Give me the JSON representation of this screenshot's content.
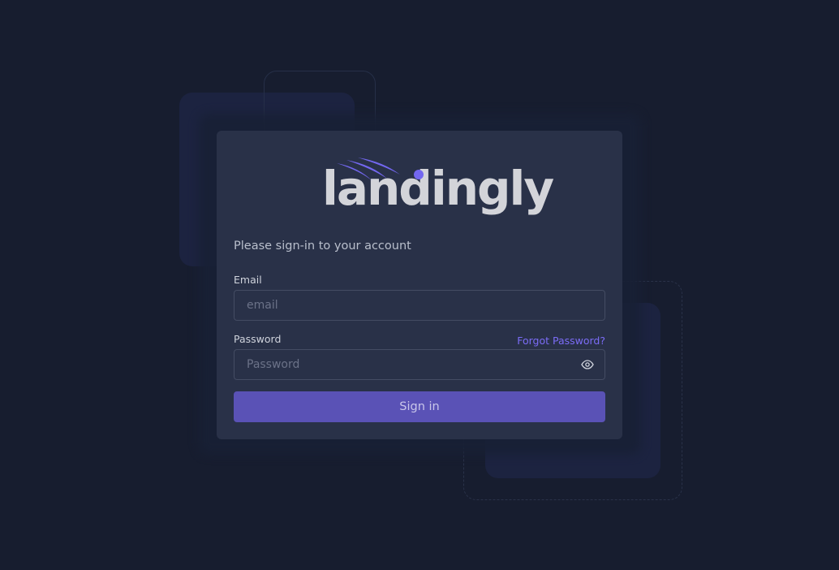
{
  "brand": {
    "name": "landingly",
    "logo_text_color": "#d3d4d9",
    "accent_color": "#7367f0"
  },
  "login": {
    "subtitle": "Please sign-in to your account",
    "email_label": "Email",
    "email_placeholder": "email",
    "password_label": "Password",
    "password_placeholder": "Password",
    "forgot_link": "Forgot Password?",
    "submit_label": "Sign in",
    "password_toggle_icon": "eye-icon"
  },
  "colors": {
    "background": "#171d2f",
    "card": "#293148",
    "button": "#5a52b6",
    "link": "#7b6cf6"
  }
}
